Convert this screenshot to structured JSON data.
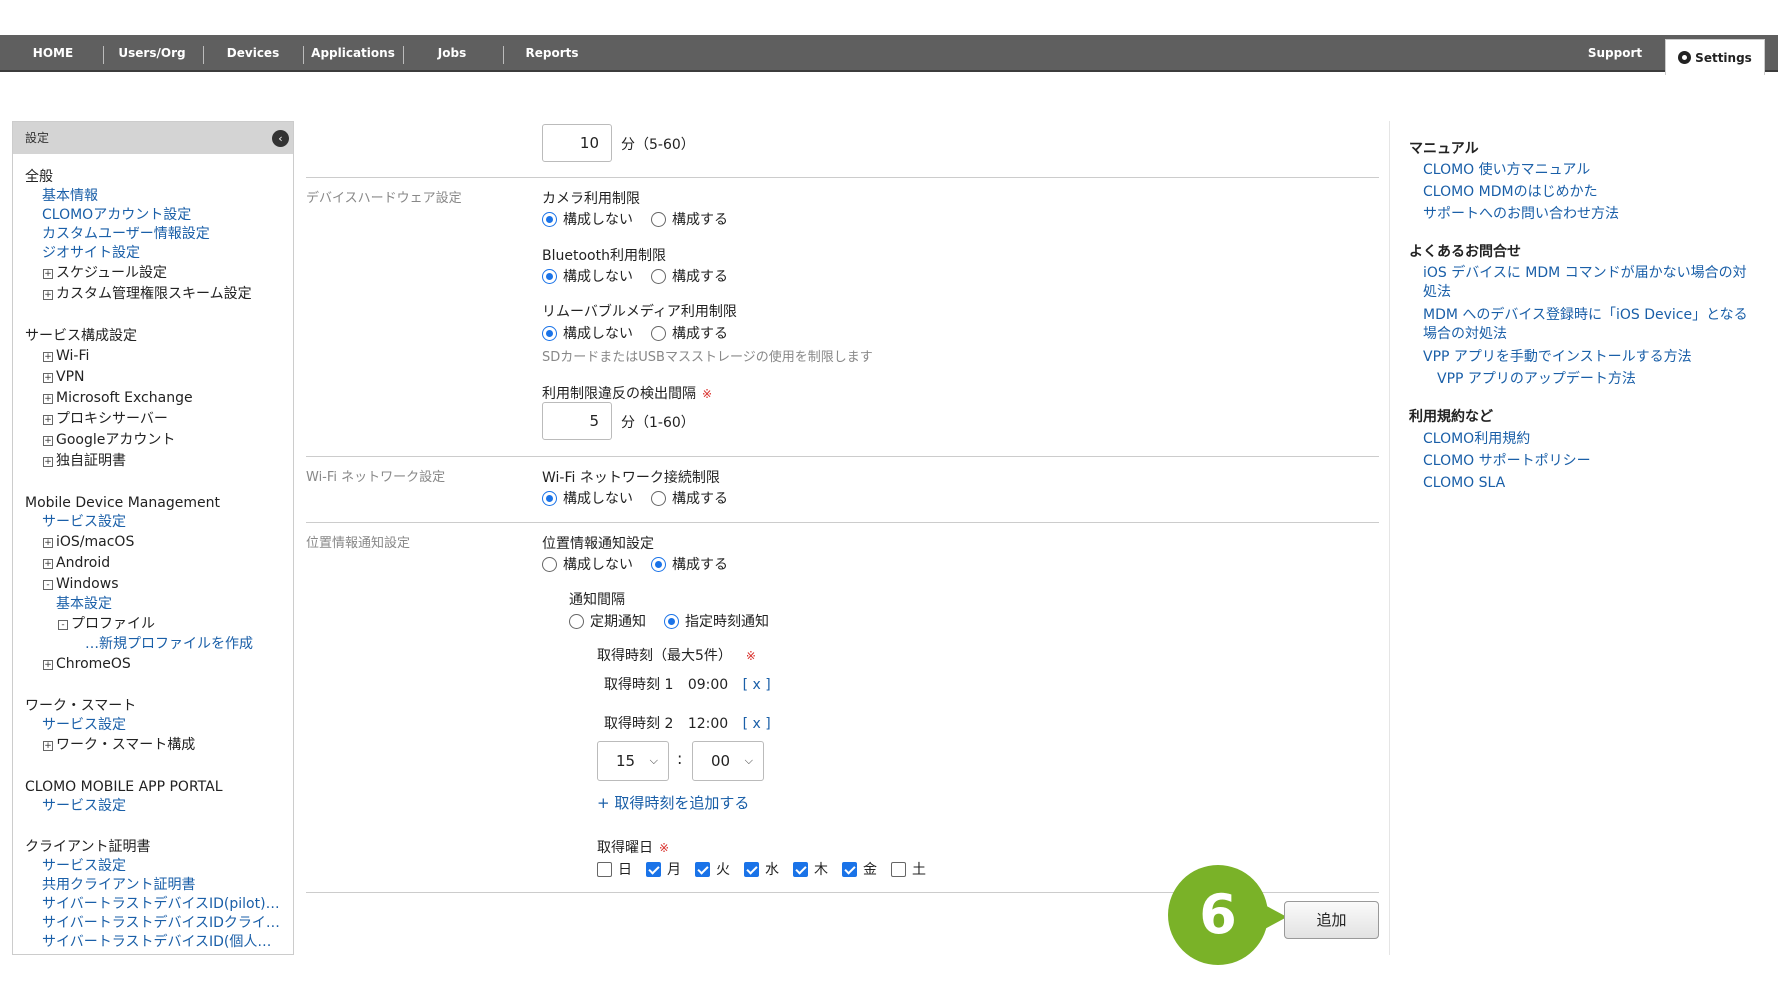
{
  "nav": {
    "items": [
      "HOME",
      "Users/Org",
      "Devices",
      "Applications",
      "Jobs",
      "Reports"
    ],
    "support": "Support",
    "settings": "Settings"
  },
  "sidebar": {
    "header": "設定",
    "sections": [
      {
        "title": "全般",
        "items": [
          {
            "type": "link",
            "label": "基本情報"
          },
          {
            "type": "link",
            "label": "CLOMOアカウント設定"
          },
          {
            "type": "link",
            "label": "カスタムユーザー情報設定"
          },
          {
            "type": "link",
            "label": "ジオサイト設定"
          },
          {
            "type": "tree",
            "label": "スケジュール設定",
            "icon": "+"
          },
          {
            "type": "tree",
            "label": "カスタム管理権限スキーム設定",
            "icon": "+"
          }
        ]
      },
      {
        "title": "サービス構成設定",
        "items": [
          {
            "type": "tree",
            "label": "Wi-Fi",
            "icon": "+"
          },
          {
            "type": "tree",
            "label": "VPN",
            "icon": "+"
          },
          {
            "type": "tree",
            "label": "Microsoft Exchange",
            "icon": "+"
          },
          {
            "type": "tree",
            "label": "プロキシサーバー",
            "icon": "+"
          },
          {
            "type": "tree",
            "label": "Googleアカウント",
            "icon": "+"
          },
          {
            "type": "tree",
            "label": "独自証明書",
            "icon": "+"
          }
        ]
      },
      {
        "title": "Mobile Device Management",
        "items": [
          {
            "type": "link",
            "label": "サービス設定"
          },
          {
            "type": "tree",
            "label": "iOS/macOS",
            "icon": "+"
          },
          {
            "type": "tree",
            "label": "Android",
            "icon": "+"
          },
          {
            "type": "tree",
            "label": "Windows",
            "icon": "-"
          },
          {
            "type": "link2",
            "label": "基本設定"
          },
          {
            "type": "tree2",
            "label": "プロファイル",
            "icon": "-"
          },
          {
            "type": "link3",
            "label": "…新規プロファイルを作成"
          },
          {
            "type": "tree",
            "label": "ChromeOS",
            "icon": "+"
          }
        ]
      },
      {
        "title": "ワーク・スマート",
        "items": [
          {
            "type": "link",
            "label": "サービス設定"
          },
          {
            "type": "tree",
            "label": "ワーク・スマート構成",
            "icon": "+"
          }
        ]
      },
      {
        "title": "CLOMO MOBILE APP PORTAL",
        "items": [
          {
            "type": "link",
            "label": "サービス設定"
          }
        ]
      },
      {
        "title": "クライアント証明書",
        "items": [
          {
            "type": "link",
            "label": "サービス設定"
          },
          {
            "type": "link",
            "label": "共用クライアント証明書"
          },
          {
            "type": "link",
            "label": "サイバートラストデバイスID(pilot)…"
          },
          {
            "type": "link",
            "label": "サイバートラストデバイスIDクライ…"
          },
          {
            "type": "link",
            "label": "サイバートラストデバイスID(個人…"
          }
        ]
      }
    ]
  },
  "main": {
    "top_interval": {
      "value": "10",
      "unit": "分（5-60）"
    },
    "hardware": {
      "section_label": "デバイスハードウェア設定",
      "camera": {
        "label": "カメラ利用制限",
        "opt1": "構成しない",
        "opt2": "構成する"
      },
      "bluetooth": {
        "label": "Bluetooth利用制限",
        "opt1": "構成しない",
        "opt2": "構成する"
      },
      "removable": {
        "label": "リムーバブルメディア利用制限",
        "opt1": "構成しない",
        "opt2": "構成する",
        "hint": "SDカードまたはUSBマスストレージの使用を制限します"
      },
      "detect": {
        "label": "利用制限違反の検出間隔",
        "req": "※",
        "value": "5",
        "unit": "分（1-60）"
      }
    },
    "wifi": {
      "section_label": "Wi-Fi ネットワーク設定",
      "label": "Wi-Fi ネットワーク接続制限",
      "opt1": "構成しない",
      "opt2": "構成する"
    },
    "location": {
      "section_label": "位置情報通知設定",
      "label": "位置情報通知設定",
      "opt1": "構成しない",
      "opt2": "構成する",
      "interval_label": "通知間隔",
      "interval_opt1": "定期通知",
      "interval_opt2": "指定時刻通知",
      "times_label": "取得時刻（最大5件）",
      "req": "※",
      "time1_label": "取得時刻 1",
      "time1_value": "09:00",
      "remove": "[ x ]",
      "time2_label": "取得時刻 2",
      "time2_value": "12:00",
      "hour": "15",
      "colon": ":",
      "minute": "00",
      "add_time": "+ 取得時刻を追加する",
      "days_label": "取得曜日",
      "days": [
        {
          "label": "日",
          "checked": false
        },
        {
          "label": "月",
          "checked": true
        },
        {
          "label": "火",
          "checked": true
        },
        {
          "label": "水",
          "checked": true
        },
        {
          "label": "木",
          "checked": true
        },
        {
          "label": "金",
          "checked": true
        },
        {
          "label": "土",
          "checked": false
        }
      ]
    },
    "add_button": "追加",
    "step_number": "6",
    "accent_color": "#7ab228"
  },
  "right": {
    "manual_title": "マニュアル",
    "manual_links": [
      "CLOMO 使い方マニュアル",
      "CLOMO MDMのはじめかた",
      "サポートへのお問い合わせ方法"
    ],
    "faq_title": "よくあるお問合せ",
    "faq_links": [
      "iOS デバイスに MDM コマンドが届かない場合の対処法",
      "MDM へのデバイス登録時に「iOS Device」となる場合の対処法",
      "VPP アプリを手動でインストールする方法",
      "VPP アプリのアップデート方法"
    ],
    "terms_title": "利用規約など",
    "terms_links": [
      "CLOMO利用規約",
      "CLOMO サポートポリシー",
      "CLOMO SLA"
    ]
  }
}
